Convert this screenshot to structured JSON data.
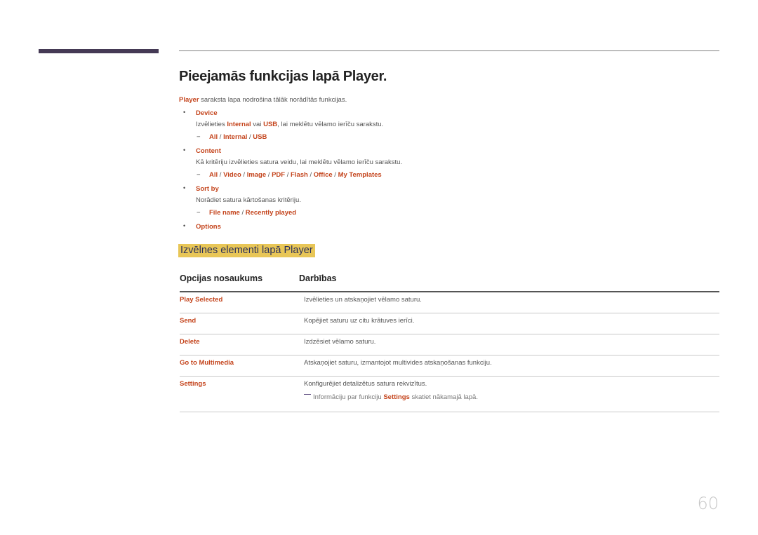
{
  "header": {
    "title": "Pieejamās funkcijas lapā Player."
  },
  "intro": {
    "highlight": "Player",
    "text": " saraksta lapa nodrošina tālāk norādītās funkcijas."
  },
  "features": [
    {
      "label": "Device",
      "desc_parts": [
        "Izvēlieties ",
        "Internal",
        " vai ",
        "USB",
        ", lai meklētu vēlamo ierīču sarakstu."
      ],
      "options": [
        "All",
        "Internal",
        "USB"
      ]
    },
    {
      "label": "Content",
      "desc": "Kā kritēriju izvēlieties satura veidu, lai meklētu vēlamo ierīču sarakstu.",
      "options": [
        "All",
        "Video",
        "Image",
        "PDF",
        "Flash",
        "Office",
        "My Templates"
      ]
    },
    {
      "label": "Sort by",
      "desc": "Norādiet satura kārtošanas kritēriju.",
      "options": [
        "File name",
        "Recently played"
      ]
    },
    {
      "label": "Options"
    }
  ],
  "bullet_glyph": "•",
  "dash_glyph": "−",
  "separator": " / ",
  "section": {
    "heading": "Izvēlnes elementi lapā Player"
  },
  "table": {
    "headers": [
      "Opcijas nosaukums",
      "Darbības"
    ],
    "rows": [
      {
        "name": "Play Selected",
        "action": "Izvēlieties un atskaņojiet vēlamo saturu."
      },
      {
        "name": "Send",
        "action": "Kopējiet saturu uz citu krātuves ierīci."
      },
      {
        "name": "Delete",
        "action": "Izdzēsiet vēlamo saturu."
      },
      {
        "name": "Go to Multimedia",
        "action": "Atskaņojiet saturu, izmantojot multivides atskaņošanas funkciju."
      },
      {
        "name": "Settings",
        "action": "Konfigurējiet detalizētus satura rekvizītus.",
        "note": {
          "before": "Informāciju par funkciju ",
          "highlight": "Settings",
          "after": " skatiet nākamajā lapā."
        }
      }
    ]
  },
  "colors": {
    "accent": "#c4441c",
    "heading_highlight": "#e8c657",
    "header_bar": "#453a55"
  },
  "page_number": "60"
}
